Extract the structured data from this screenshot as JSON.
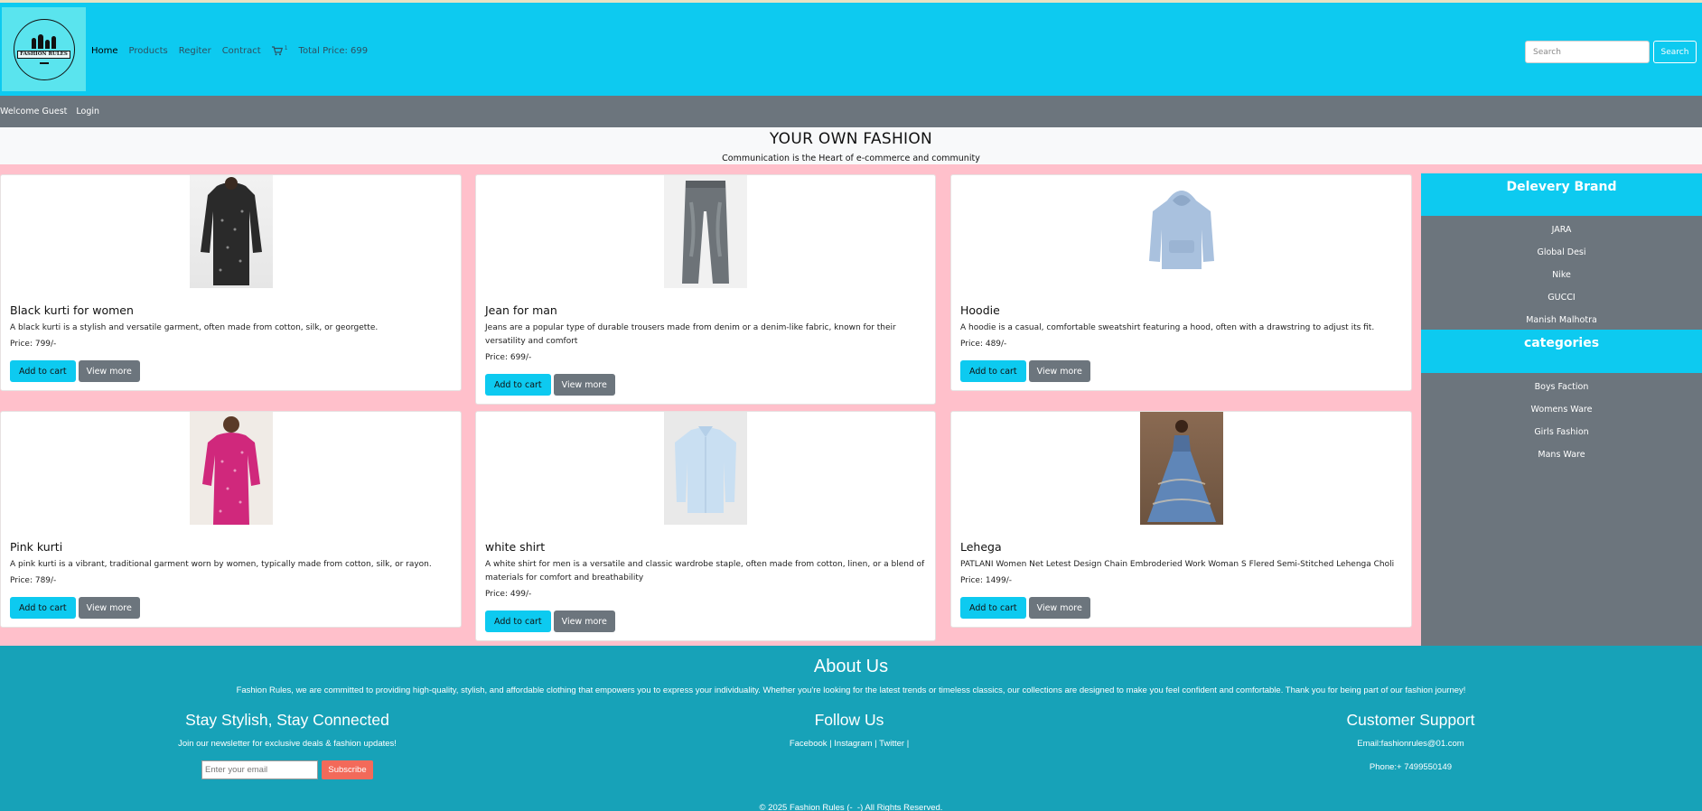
{
  "header": {
    "logo_alt": "FASHION RULES",
    "nav": [
      "Home",
      "Products",
      "Regiter",
      "Contract"
    ],
    "cart_count": "1",
    "total_price": "Total Price: 699",
    "search_placeholder": "Search",
    "search_button": "Search"
  },
  "userbar": {
    "welcome": "Welcome Guest",
    "login": "Login"
  },
  "banner": {
    "title": "YOUR OWN FASHION",
    "subtitle": "Communication is the Heart of e-commerce and community"
  },
  "products": [
    {
      "name": "Black kurti for women",
      "desc": "A black kurti is a stylish and versatile garment, often made from cotton, silk, or georgette.",
      "price": "Price: 799/-",
      "add": "Add to cart",
      "more": "View more"
    },
    {
      "name": "Jean for man",
      "desc": "Jeans are a popular type of durable trousers made from denim or a denim-like fabric, known for their versatility and comfort",
      "price": "Price: 699/-",
      "add": "Add to cart",
      "more": "View more"
    },
    {
      "name": "Hoodie",
      "desc": "A hoodie is a casual, comfortable sweatshirt featuring a hood, often with a drawstring to adjust its fit.",
      "price": "Price: 489/-",
      "add": "Add to cart",
      "more": "View more"
    },
    {
      "name": "Pink kurti",
      "desc": "A pink kurti is a vibrant, traditional garment worn by women, typically made from cotton, silk, or rayon.",
      "price": "Price: 789/-",
      "add": "Add to cart",
      "more": "View more"
    },
    {
      "name": "white shirt",
      "desc": "A white shirt for men is a versatile and classic wardrobe staple, often made from cotton, linen, or a blend of materials for comfort and breathability",
      "price": "Price: 499/-",
      "add": "Add to cart",
      "more": "View more"
    },
    {
      "name": "Lehega",
      "desc": "PATLANI Women Net Letest Design Chain Embroderied Work Woman S Flered Semi-Stitched Lehenga Choli",
      "price": "Price: 1499/-",
      "add": "Add to cart",
      "more": "View more"
    }
  ],
  "sidebar": {
    "brand_title": "Delevery Brand",
    "brands": [
      "JARA",
      "Global Desi",
      "Nike",
      "GUCCI",
      "Manish Malhotra"
    ],
    "categories_title": "categories",
    "categories": [
      "Boys Faction",
      "Womens Ware",
      "Girls Fashion",
      "Mans Ware"
    ]
  },
  "footer": {
    "about_title": "About Us",
    "about_text": "Fashion Rules, we are committed to providing high-quality, stylish, and affordable clothing that empowers you to express your individuality. Whether you're looking for the latest trends or timeless classics, our collections are designed to make you feel confident and comfortable. Thank you for being part of our fashion journey!",
    "newsletter_title": "Stay Stylish, Stay Connected",
    "newsletter_text": "Join our newsletter for exclusive deals & fashion updates!",
    "email_placeholder": "Enter your email",
    "subscribe": "Subscribe",
    "follow_title": "Follow Us",
    "follow_links": "Facebook | Instagram | Twitter |",
    "support_title": "Customer Support",
    "support_email": "Email:fashionrules@01.com",
    "support_phone": "Phone:+ 7499550149",
    "copyright": "© 2025 Fashion Rules (-_-) All Rights Reserved."
  },
  "colors": {
    "header": "#0dcaf0",
    "bar": "#6c757d",
    "page": "#ffc0cb",
    "footer": "#17a2b8",
    "subscribe": "#f26a5a"
  }
}
